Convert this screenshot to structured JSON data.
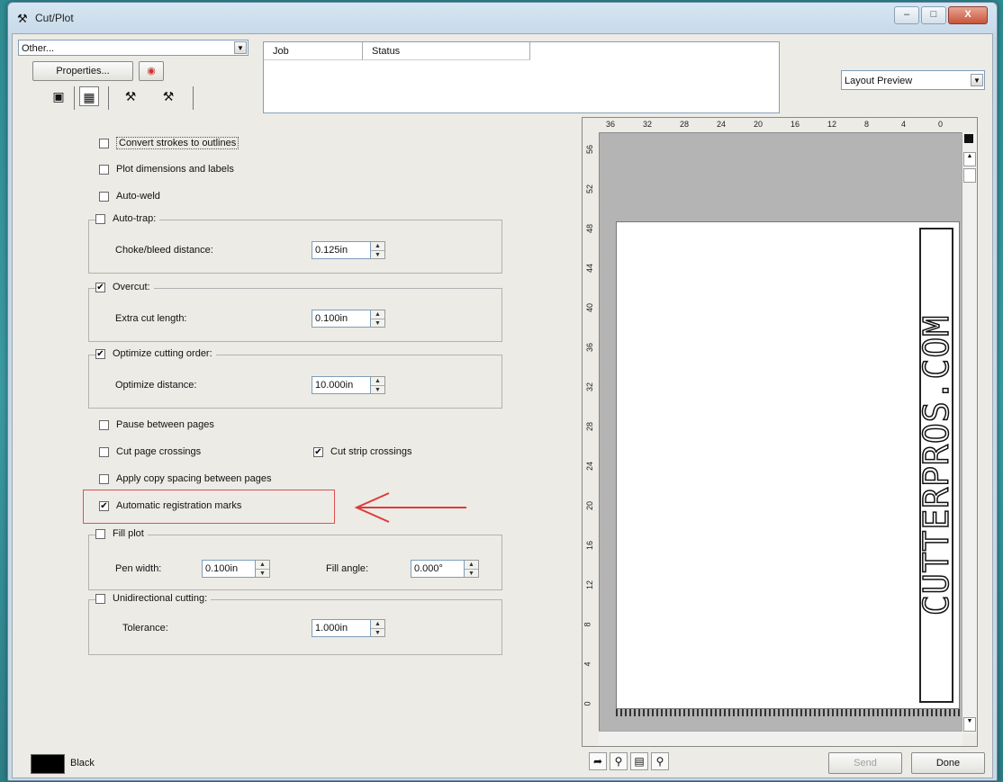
{
  "window": {
    "title": "Cut/Plot",
    "minimize": "–",
    "maximize": "□",
    "close": "X"
  },
  "device_combo": "Other...",
  "properties_label": "Properties...",
  "joblist": {
    "columns": [
      "Job",
      "Status"
    ]
  },
  "view_combo": "Layout Preview",
  "options": {
    "convert_strokes": "Convert strokes to outlines",
    "plot_dimensions": "Plot dimensions and labels",
    "auto_weld": "Auto-weld",
    "auto_trap": "Auto-trap:",
    "choke_label": "Choke/bleed distance:",
    "choke_value": "0.125in",
    "overcut": "Overcut:",
    "extra_cut_label": "Extra cut length:",
    "extra_cut_value": "0.100in",
    "optimize_order": "Optimize cutting order:",
    "optimize_distance_label": "Optimize distance:",
    "optimize_distance_value": "10.000in",
    "pause_pages": "Pause between pages",
    "cut_page_crossings": "Cut page crossings",
    "cut_strip_crossings": "Cut strip crossings",
    "apply_copy_spacing": "Apply copy spacing between pages",
    "auto_reg_marks": "Automatic registration marks",
    "fill_plot": "Fill plot",
    "pen_width_label": "Pen width:",
    "pen_width_value": "0.100in",
    "fill_angle_label": "Fill angle:",
    "fill_angle_value": "0.000°",
    "unidirectional": "Unidirectional cutting:",
    "tolerance_label": "Tolerance:",
    "tolerance_value": "1.000in"
  },
  "check_mark": "✔",
  "preview": {
    "ruler_top": [
      "36",
      "32",
      "28",
      "24",
      "20",
      "16",
      "12",
      "8",
      "4",
      "0"
    ],
    "ruler_left": [
      "56",
      "52",
      "48",
      "44",
      "40",
      "36",
      "32",
      "28",
      "24",
      "20",
      "16",
      "12",
      "8",
      "4",
      "0"
    ],
    "artwork_text": "CUTTERPROS.COM"
  },
  "color_name": "Black",
  "send_label": "Send",
  "done_label": "Done",
  "colors": {
    "accent_red": "#e03a3a",
    "window_frame": "#c5d8e8"
  }
}
